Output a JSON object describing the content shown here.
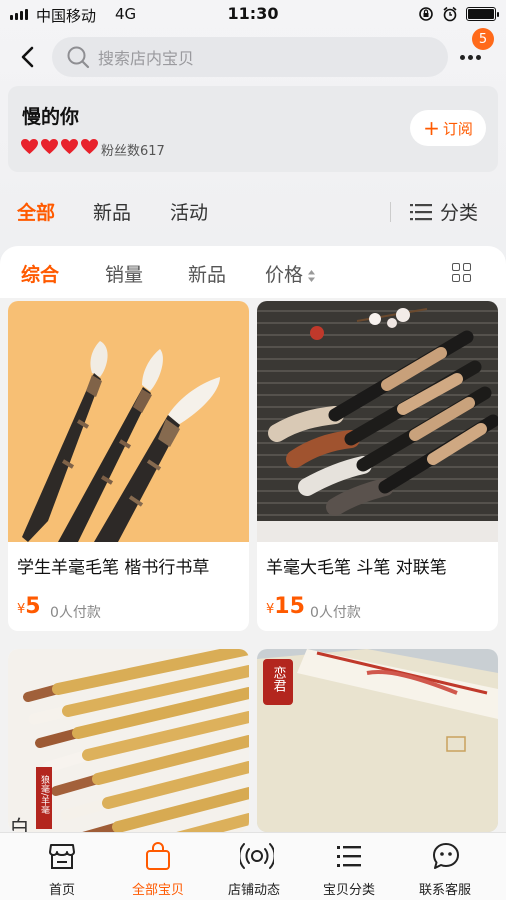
{
  "status_bar": {
    "carrier": "中国移动",
    "network": "4G",
    "time": "11:30"
  },
  "search": {
    "placeholder": "搜索店内宝贝"
  },
  "notification_count": "5",
  "shop": {
    "name": "慢的你",
    "fans": "粉丝数617",
    "subscribe_label": "订阅",
    "hearts": 4
  },
  "main_tabs": [
    {
      "label": "全部"
    },
    {
      "label": "新品"
    },
    {
      "label": "活动"
    }
  ],
  "category_label": "分类",
  "sort_tabs": [
    {
      "label": "综合"
    },
    {
      "label": "销量"
    },
    {
      "label": "新品"
    },
    {
      "label": "价格"
    }
  ],
  "products": [
    {
      "title": "学生羊毫毛笔 楷书行书草",
      "currency": "¥",
      "price": "5",
      "sold": "0人付款"
    },
    {
      "title": "羊毫大毛笔 斗笔 对联笔",
      "currency": "¥",
      "price": "15",
      "sold": "0人付款"
    },
    {
      "image_text": "白云书",
      "badge_text": "狼毫/羊毫"
    },
    {
      "seal_text": "恋君"
    }
  ],
  "tab_bar": [
    {
      "label": "首页",
      "icon": "store-icon"
    },
    {
      "label": "全部宝贝",
      "icon": "shopping-bag-icon"
    },
    {
      "label": "店铺动态",
      "icon": "broadcast-icon"
    },
    {
      "label": "宝贝分类",
      "icon": "list-icon"
    },
    {
      "label": "联系客服",
      "icon": "chat-icon"
    }
  ],
  "colors": {
    "accent": "#ff5a00",
    "badge": "#ff6a1a",
    "heart": "#e8222c"
  }
}
